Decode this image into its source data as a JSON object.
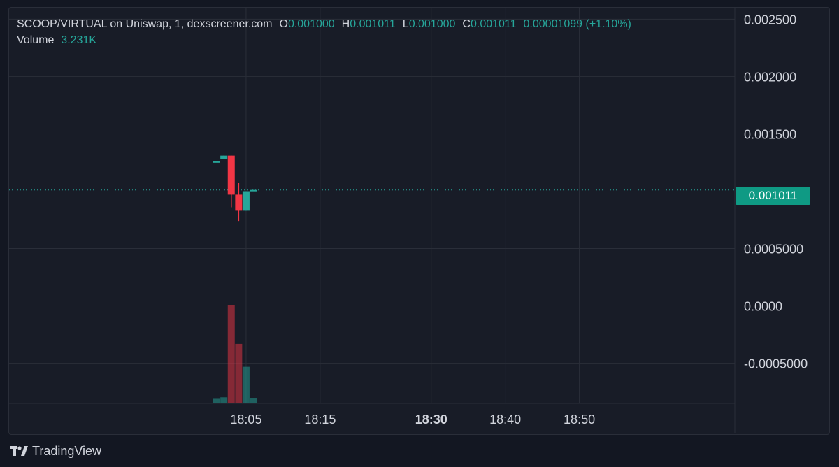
{
  "legend": {
    "symbol": "SCOOP/VIRTUAL on Uniswap, 1, dexscreener.com",
    "open_label": "O",
    "open": "0.001000",
    "high_label": "H",
    "high": "0.001011",
    "low_label": "L",
    "low": "0.001000",
    "close_label": "C",
    "close": "0.001011",
    "change": "0.00001099 (+1.10%)",
    "volume_label": "Volume",
    "volume": "3.231K"
  },
  "last_price": "0.001011",
  "brand": "TradingView",
  "colors": {
    "up": "#26a69a",
    "down": "#f23645",
    "background": "#181c27",
    "grid": "#2a2e39",
    "text": "#d1d4dc"
  },
  "chart_data": {
    "type": "candlestick",
    "title": "SCOOP/VIRTUAL on Uniswap, 1, dexscreener.com",
    "y_ticks": [
      "0.002500",
      "0.002000",
      "0.001500",
      "0.0005000",
      "0.0000",
      "-0.0005000"
    ],
    "y_tick_values": [
      0.0025,
      0.002,
      0.0015,
      0.0005,
      0.0,
      -0.0005
    ],
    "x_ticks": [
      "18:05",
      "18:15",
      "18:30",
      "18:40",
      "18:50"
    ],
    "x_tick_minutes": [
      5,
      15,
      30,
      40,
      50
    ],
    "bold_x_tick": "18:30",
    "ylim": [
      -0.00085,
      0.0026
    ],
    "xlim_minutes": [
      -27,
      71
    ],
    "last_price_value": 0.001011,
    "grid": true,
    "candles": [
      {
        "t": 1,
        "open": 0.00126,
        "high": 0.00126,
        "low": 0.00125,
        "close": 0.00126
      },
      {
        "t": 2,
        "open": 0.00128,
        "high": 0.00131,
        "low": 0.00128,
        "close": 0.00131
      },
      {
        "t": 3,
        "open": 0.00131,
        "high": 0.00131,
        "low": 0.00086,
        "close": 0.00097
      },
      {
        "t": 4,
        "open": 0.00097,
        "high": 0.00107,
        "low": 0.00074,
        "close": 0.00083
      },
      {
        "t": 5,
        "open": 0.00083,
        "high": 0.001,
        "low": 0.00083,
        "close": 0.001
      },
      {
        "t": 6,
        "open": 0.001,
        "high": 0.001011,
        "low": 0.001,
        "close": 0.001011
      }
    ],
    "volume": [
      {
        "t": 1,
        "value": 0.15,
        "dir": "up"
      },
      {
        "t": 2,
        "value": 0.2,
        "dir": "up"
      },
      {
        "t": 3,
        "value": 3.231,
        "dir": "down"
      },
      {
        "t": 4,
        "value": 1.95,
        "dir": "down"
      },
      {
        "t": 5,
        "value": 1.2,
        "dir": "up"
      },
      {
        "t": 6,
        "value": 0.16,
        "dir": "up"
      }
    ]
  }
}
